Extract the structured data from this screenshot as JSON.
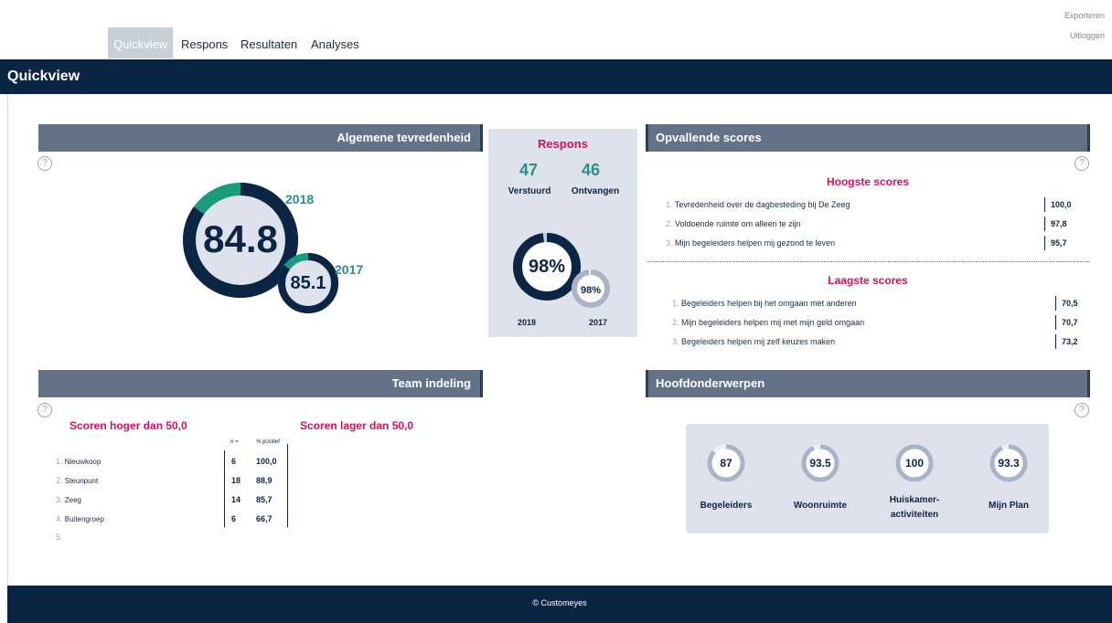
{
  "nav": {
    "tabs": [
      {
        "label": "Quickview",
        "active": true
      },
      {
        "label": "Respons"
      },
      {
        "label": "Resultaten"
      },
      {
        "label": "Analyses"
      }
    ],
    "export_label": "Exporteren",
    "logout_label": "Uitloggen"
  },
  "page_title": "Quickview",
  "help_glyph": "?",
  "tevredenheid": {
    "header": "Algemene tevredenheid",
    "current": {
      "year": "2018",
      "value": "84.8",
      "fraction": 0.848
    },
    "previous": {
      "year": "2017",
      "value": "85.1",
      "fraction": 0.851
    }
  },
  "respons": {
    "title": "Respons",
    "sent_value": "47",
    "sent_label": "Verstuurd",
    "received_value": "46",
    "received_label": "Ontvangen",
    "current": {
      "year": "2018",
      "value": "98%",
      "fraction": 0.98
    },
    "previous": {
      "year": "2017",
      "value": "98%",
      "fraction": 0.98
    }
  },
  "opvallend": {
    "header": "Opvallende scores",
    "highest_title": "Hoogste scores",
    "highest": [
      {
        "num": "1.",
        "label": "Tevredenheid over de dagbesteding bij De Zeeg",
        "value": "100,0"
      },
      {
        "num": "2.",
        "label": "Voldoende ruimte om alleen te zijn",
        "value": "97,8"
      },
      {
        "num": "3.",
        "label": "Mijn begeleiders helpen mij gezond te leven",
        "value": "95,7"
      }
    ],
    "lowest_title": "Laagste scores",
    "lowest": [
      {
        "num": "1.",
        "label": "Begeleiders helpen bij het omgaan met anderen",
        "value": "70,5"
      },
      {
        "num": "2.",
        "label": "Mijn begeleiders helpen mij met mijn geld omgaan",
        "value": "70,7"
      },
      {
        "num": "3.",
        "label": "Begeleiders helpen mij zelf keuzes maken",
        "value": "73,2"
      }
    ]
  },
  "team": {
    "header": "Team indeling",
    "higher_title": "Scoren hoger dan 50,0",
    "lower_title": "Scoren lager dan 50,0",
    "col_n": "n =",
    "col_pct": "% positief",
    "rows": [
      {
        "num": "1.",
        "name": "Nieuwkoop",
        "n": "6",
        "pct": "100,0"
      },
      {
        "num": "2.",
        "name": "Steunpunt",
        "n": "18",
        "pct": "88,9"
      },
      {
        "num": "3.",
        "name": "Zeeg",
        "n": "14",
        "pct": "85,7"
      },
      {
        "num": "4.",
        "name": "Buitengroep",
        "n": "6",
        "pct": "66,7"
      }
    ],
    "empty_row_num": "5."
  },
  "hoofd": {
    "header": "Hoofdonderwerpen",
    "topics": [
      {
        "value": "87",
        "label": "Begeleiders",
        "fraction": 0.87
      },
      {
        "value": "93.5",
        "label": "Woonruimte",
        "fraction": 0.935
      },
      {
        "value": "100",
        "label": "Huiskamer-activiteiten",
        "fraction": 1.0
      },
      {
        "value": "93.3",
        "label": "Mijn Plan",
        "fraction": 0.933
      }
    ]
  },
  "footer": "© Customeyes",
  "colors": {
    "navy": "#0b2545",
    "teal": "#1a9b7e",
    "pink": "#d6105f",
    "header_gray": "#647288",
    "light_ring": "#a9b4c8",
    "panel_bg": "#dde2ec"
  }
}
